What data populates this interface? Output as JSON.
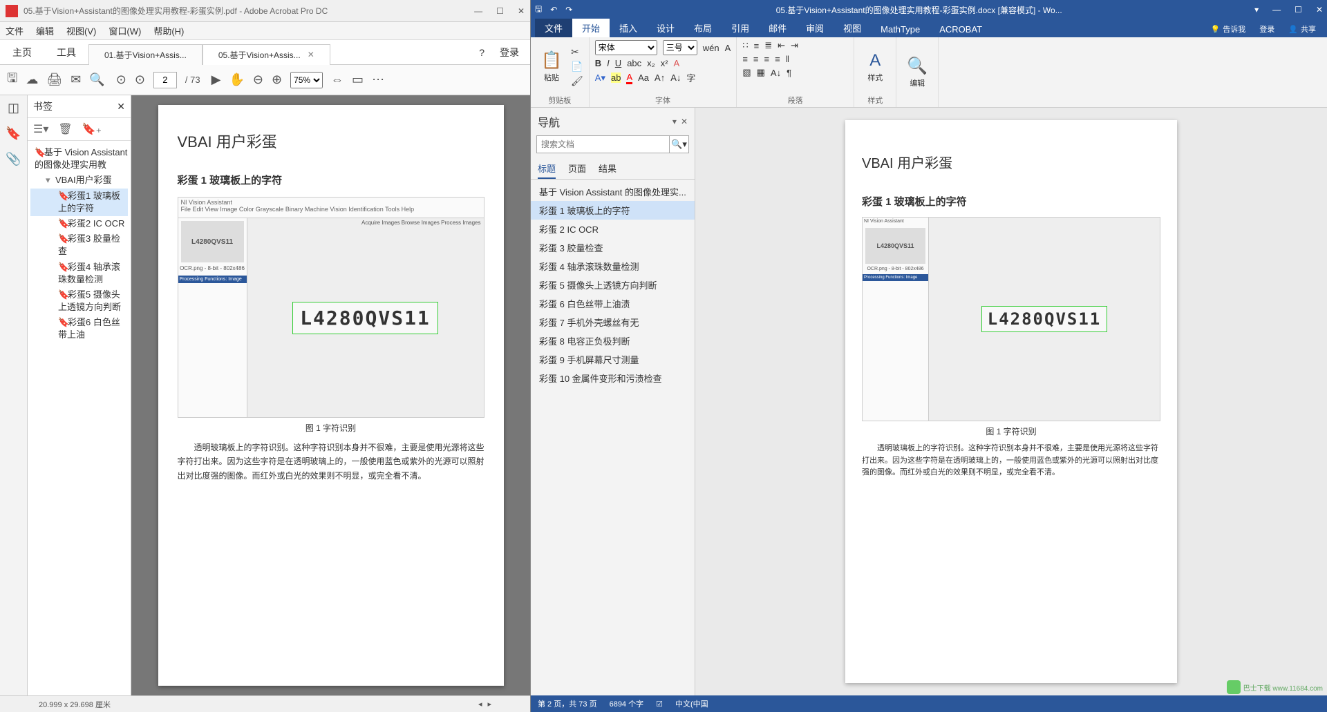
{
  "acrobat": {
    "title": "05.基于Vision+Assistant的图像处理实用教程-彩蛋实例.pdf - Adobe Acrobat Pro DC",
    "menu": [
      "文件",
      "编辑",
      "视图(V)",
      "窗口(W)",
      "帮助(H)"
    ],
    "big_tabs": {
      "home": "主页",
      "tools": "工具"
    },
    "doc_tabs": [
      {
        "label": "01.基于Vision+Assis...",
        "active": false
      },
      {
        "label": "05.基于Vision+Assis...",
        "active": true
      }
    ],
    "login": "登录",
    "page_current": "2",
    "page_total": "/ 73",
    "zoom": "75%",
    "bookmarks_title": "书签",
    "bookmarks": [
      {
        "level": 1,
        "label": "基于 Vision Assistant 的图像处理实用教",
        "selected": false
      },
      {
        "level": 2,
        "label": "VBAI用户彩蛋",
        "selected": false,
        "exp": true
      },
      {
        "level": 3,
        "label": "彩蛋1 玻璃板上的字符",
        "selected": true
      },
      {
        "level": 3,
        "label": "彩蛋2 IC OCR",
        "selected": false
      },
      {
        "level": 3,
        "label": "彩蛋3 胶量检查",
        "selected": false
      },
      {
        "level": 3,
        "label": "彩蛋4 轴承滚珠数量检测",
        "selected": false
      },
      {
        "level": 3,
        "label": "彩蛋5 摄像头上透镜方向判断",
        "selected": false
      },
      {
        "level": 3,
        "label": "彩蛋6 白色丝带上油",
        "selected": false
      }
    ],
    "status": "20.999 x 29.698 厘米"
  },
  "doc": {
    "h1": "VBAI 用户彩蛋",
    "h2": "彩蛋 1  玻璃板上的字符",
    "fig_app": "NI Vision Assistant",
    "fig_menu": "File  Edit  View  Image  Color  Grayscale  Binary  Machine Vision  Identification  Tools  Help",
    "fig_tabs": "Acquire Images   Browse Images   Process Images",
    "strip_label": "L4280QVS11",
    "strip_file": "OCR.png - 8-bit - 802x486",
    "ocr_text": "L4280QVS11",
    "fig_caption": "图 1  字符识别",
    "body": "透明玻璃板上的字符识别。这种字符识别本身并不很难，主要是使用光源将这些字符打出来。因为这些字符是在透明玻璃上的，一般使用蓝色或紫外的光源可以照射出对比度强的图像。而红外或白光的效果则不明显，或完全看不清。",
    "body_word": "透明玻璃板上的字符识别。这种字符识别本身并不很难，主要是使用光源将这些字符打出来。因为这些字符是在透明玻璃上的，一般使用蓝色或紫外的光源可以照射出对比度强的图像。而红外或白光的效果则不明显，或完全看不清。"
  },
  "word": {
    "title": "05.基于Vision+Assistant的图像处理实用教程-彩蛋实例.docx [兼容模式] - Wo...",
    "ribbon_tabs": [
      "文件",
      "开始",
      "插入",
      "设计",
      "布局",
      "引用",
      "邮件",
      "审阅",
      "视图",
      "MathType",
      "ACROBAT"
    ],
    "tell_me": "告诉我",
    "signin": "登录",
    "share": "共享",
    "font_name": "宋体",
    "font_size": "三号",
    "groups": {
      "clipboard": "剪贴板",
      "font": "字体",
      "paragraph": "段落",
      "styles": "样式",
      "editing": "编辑"
    },
    "paste": "粘贴",
    "styles_btn": "样式",
    "editing_btn": "编辑",
    "nav": {
      "title": "导航",
      "placeholder": "搜索文档",
      "tabs": [
        "标题",
        "页面",
        "结果"
      ],
      "items": [
        {
          "label": "基于 Vision Assistant 的图像处理实...",
          "selected": false
        },
        {
          "label": "彩蛋 1  玻璃板上的字符",
          "selected": true
        },
        {
          "label": "彩蛋 2 IC OCR",
          "selected": false
        },
        {
          "label": "彩蛋 3  胶量检查",
          "selected": false
        },
        {
          "label": "彩蛋 4  轴承滚珠数量检测",
          "selected": false
        },
        {
          "label": "彩蛋 5  摄像头上透镜方向判断",
          "selected": false
        },
        {
          "label": "彩蛋 6  白色丝带上油渍",
          "selected": false
        },
        {
          "label": "彩蛋 7  手机外壳螺丝有无",
          "selected": false
        },
        {
          "label": "彩蛋 8  电容正负极判断",
          "selected": false
        },
        {
          "label": "彩蛋 9  手机屏幕尺寸测量",
          "selected": false
        },
        {
          "label": "彩蛋 10  金属件变形和污渍检查",
          "selected": false
        }
      ]
    },
    "status": {
      "page": "第 2 页，共 73 页",
      "words": "6894 个字",
      "lang": "中文(中国"
    }
  },
  "watermark": "巴士下载  www.11684.com"
}
